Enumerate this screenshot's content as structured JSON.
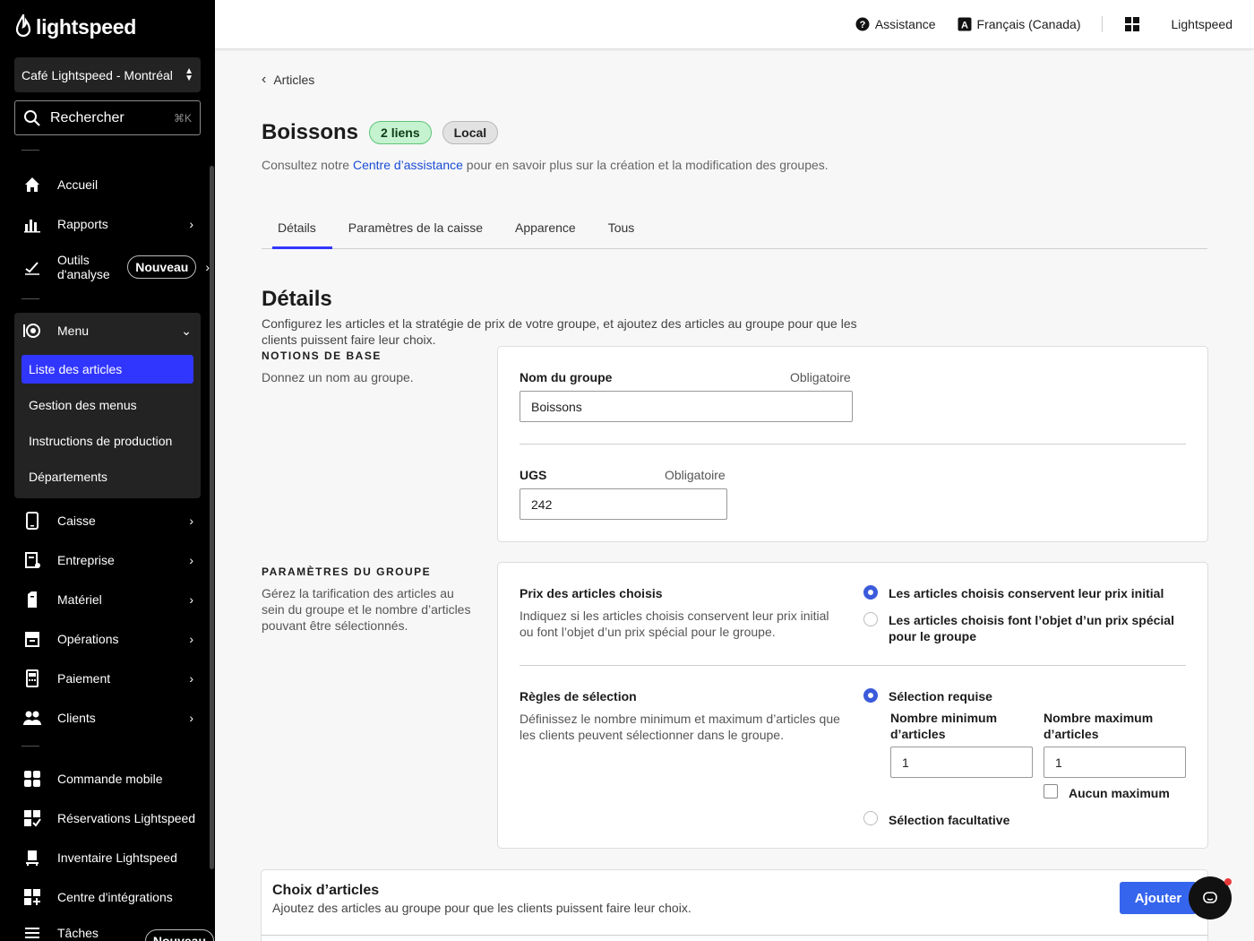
{
  "sidebar": {
    "logo": "lightspeed",
    "store": "Café Lightspeed - Montréal",
    "search_label": "Rechercher",
    "search_kbd": "⌘K",
    "items": [
      {
        "label": "Accueil",
        "icon": "home-icon"
      },
      {
        "label": "Rapports",
        "icon": "chart-icon"
      },
      {
        "label": "Outils d'analyse",
        "icon": "analytics-icon",
        "badge": "Nouveau"
      },
      {
        "label": "Caisse",
        "icon": "pos-icon"
      },
      {
        "label": "Entreprise",
        "icon": "business-icon"
      },
      {
        "label": "Matériel",
        "icon": "hardware-icon"
      },
      {
        "label": "Opérations",
        "icon": "operations-icon"
      },
      {
        "label": "Paiement",
        "icon": "payment-icon"
      },
      {
        "label": "Clients",
        "icon": "clients-icon"
      },
      {
        "label": "Commande mobile",
        "icon": "mobile-order-icon"
      },
      {
        "label": "Réservations Lightspeed",
        "icon": "reservations-icon"
      },
      {
        "label": "Inventaire Lightspeed",
        "icon": "inventory-icon"
      },
      {
        "label": "Centre d'intégrations",
        "icon": "integrations-icon"
      },
      {
        "label": "Tâches",
        "icon": "tasks-icon",
        "badge": "Nouveau"
      }
    ],
    "menu": {
      "label": "Menu",
      "subitems": [
        "Liste des articles",
        "Gestion des menus",
        "Instructions de production",
        "Départements"
      ]
    }
  },
  "topbar": {
    "assistance": "Assistance",
    "language": "Français (Canada)",
    "account": "Lightspeed"
  },
  "main": {
    "breadcrumb": "Articles",
    "title": "Boissons",
    "badge_links": "2 liens",
    "badge_local": "Local",
    "help_prefix": "Consultez notre ",
    "help_link": "Centre d’assistance",
    "help_suffix": " pour en savoir plus sur la création et la modification des groupes.",
    "tabs": [
      "Détails",
      "Paramètres de la caisse",
      "Apparence",
      "Tous"
    ],
    "section_title": "Détails",
    "section_desc": "Configurez les articles et la stratégie de prix de votre groupe, et ajoutez des articles au groupe pour que les clients puissent faire leur choix.",
    "basics": {
      "caption": "NOTIONS DE BASE",
      "desc": "Donnez un nom au groupe.",
      "name_label": "Nom du groupe",
      "name_required": "Obligatoire",
      "name_value": "Boissons",
      "sku_label": "UGS",
      "sku_required": "Obligatoire",
      "sku_value": "242"
    },
    "group_settings": {
      "caption": "PARAMÈTRES DU GROUPE",
      "desc": "Gérez la tarification des articles au sein du groupe et le nombre d’articles pouvant être sélectionnés.",
      "price_title": "Prix des articles choisis",
      "price_desc": "Indiquez si les articles choisis conservent leur prix initial ou font l’objet d’un prix spécial pour le groupe.",
      "price_opt1": "Les articles choisis conservent leur prix initial",
      "price_opt2": "Les articles choisis font l’objet d’un prix spécial pour le groupe",
      "rules_title": "Règles de sélection",
      "rules_desc": "Définissez le nombre minimum et maximum d’articles que les clients peuvent sélectionner dans le groupe.",
      "rule_required": "Sélection requise",
      "min_label": "Nombre minimum d’articles",
      "min_value": "1",
      "max_label": "Nombre maximum d’articles",
      "max_value": "1",
      "no_max": "Aucun maximum",
      "rule_optional": "Sélection facultative"
    },
    "choices": {
      "title": "Choix d’articles",
      "desc": "Ajoutez des articles au groupe pour que les clients puissent faire leur choix.",
      "add_button": "Ajouter"
    }
  },
  "colors": {
    "accent": "#3136ff",
    "link": "#1a4dd6",
    "button": "#3565ed"
  }
}
